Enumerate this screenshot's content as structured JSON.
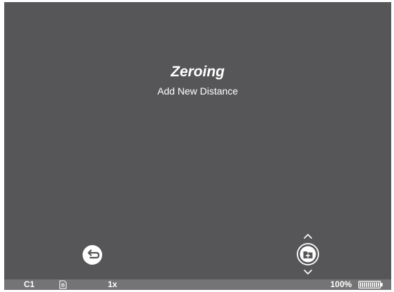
{
  "screen": {
    "title": "Zeroing",
    "subtitle": "Add New Distance"
  },
  "controls": {
    "back_icon": "back-arrow-icon",
    "add_icon": "folder-add-icon",
    "up_icon": "chevron-up-icon",
    "down_icon": "chevron-down-icon"
  },
  "statusbar": {
    "profile": "C1",
    "ballistic_icon": "ballistic-profile-icon",
    "ballistic_label": "B",
    "zoom": "1x",
    "battery_pct": "100%",
    "battery_level": 1.0
  },
  "colors": {
    "screen_bg": "#565658",
    "statusbar_bg": "#747476",
    "text": "#ffffff"
  }
}
